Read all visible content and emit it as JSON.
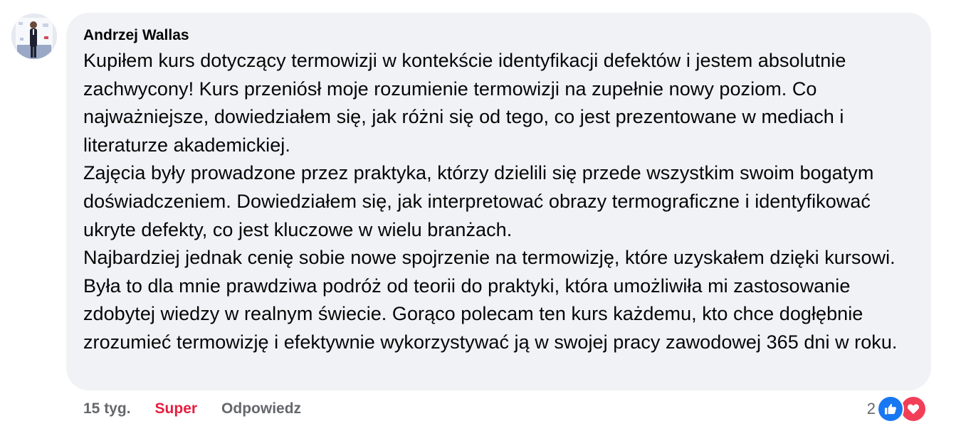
{
  "comment": {
    "author": "Andrzej Wallas",
    "paragraphs": [
      "Kupiłem kurs dotyczący termowizji w kontekście identyfikacji defektów i jestem absolutnie zachwycony! Kurs przeniósł moje rozumienie termowizji na zupełnie nowy poziom. Co najważniejsze, dowiedziałem się, jak różni się od tego, co jest prezentowane w mediach i literaturze akademickiej.",
      "Zajęcia były prowadzone przez praktyka, którzy dzielili się przede wszystkim swoim bogatym doświadczeniem. Dowiedziałem się, jak interpretować obrazy termograficzne i identyfikować ukryte defekty, co jest kluczowe w wielu branżach.",
      "Najbardziej jednak cenię sobie nowe spojrzenie na termowizję, które uzyskałem dzięki kursowi. Była to dla mnie prawdziwa podróż od teorii do praktyki, która umożliwiła mi zastosowanie zdobytej wiedzy w realnym świecie. Gorąco polecam ten kurs każdemu, kto chce dogłębnie zrozumieć termowizję i efektywnie wykorzystywać ją w swojej pracy zawodowej 365 dni w roku."
    ]
  },
  "actions": {
    "timestamp": "15 tyg.",
    "reaction_label": "Super",
    "reply_label": "Odpowiedz"
  },
  "reactions": {
    "count": "2",
    "icons": [
      "like-icon",
      "love-icon"
    ]
  },
  "colors": {
    "bubble": "#f0f2f5",
    "text": "#050505",
    "secondary": "#65676b",
    "reaction_active": "#e41e3f",
    "like_blue": "#1877f2",
    "love_red": "#f33e58"
  }
}
